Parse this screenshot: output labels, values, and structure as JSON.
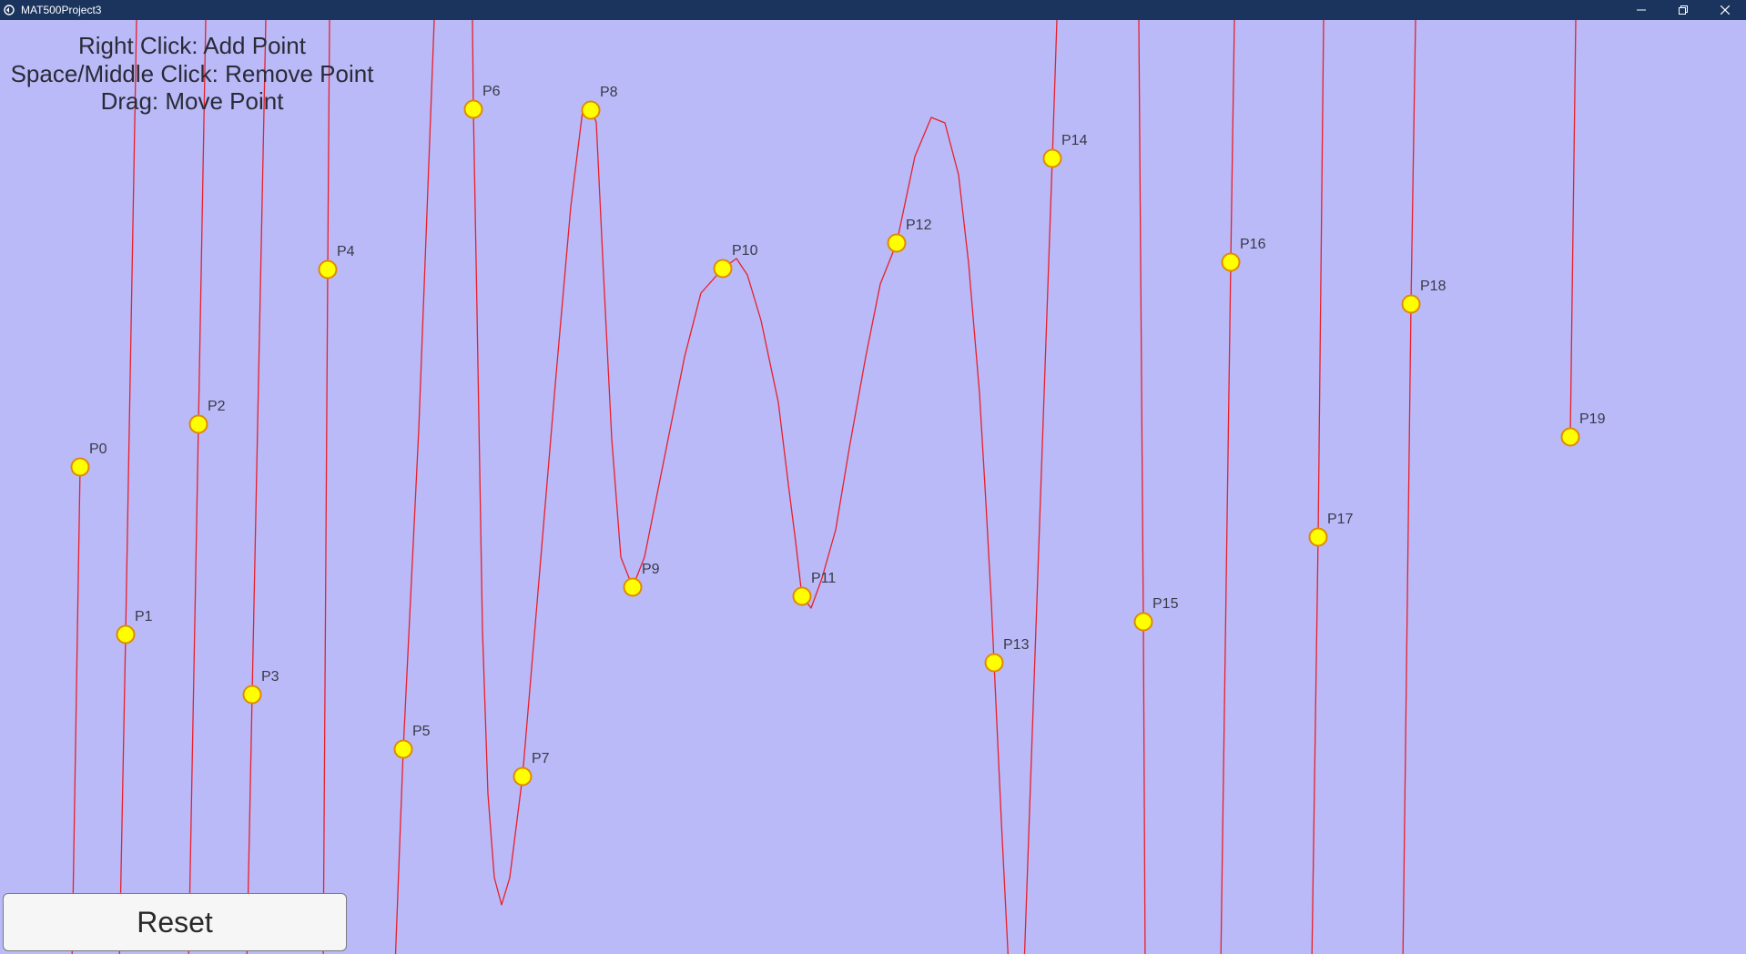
{
  "window": {
    "title": "MAT500Project3",
    "icons": {
      "app": "app-icon",
      "minimize": "minimize-icon",
      "maximize": "restore-icon",
      "close": "close-icon"
    }
  },
  "instructions": {
    "line1": "Right Click: Add Point",
    "line2": "Space/Middle Click: Remove Point",
    "line3": "Drag: Move Point"
  },
  "reset_label": "Reset",
  "colors": {
    "background": "#babaf8",
    "curve": "#e8202a",
    "point_fill": "#ffff00",
    "point_stroke": "#e08a00",
    "titlebar": "#1a345e"
  },
  "control_points": [
    {
      "label": "P0"
    },
    {
      "label": "P1"
    },
    {
      "label": "P2"
    },
    {
      "label": "P3"
    },
    {
      "label": "P4"
    },
    {
      "label": "P5"
    },
    {
      "label": "P6"
    },
    {
      "label": "P7"
    },
    {
      "label": "P8"
    },
    {
      "label": "P9"
    },
    {
      "label": "P10"
    },
    {
      "label": "P11"
    },
    {
      "label": "P12"
    },
    {
      "label": "P13"
    },
    {
      "label": "P14"
    },
    {
      "label": "P15"
    },
    {
      "label": "P16"
    },
    {
      "label": "P17"
    },
    {
      "label": "P18"
    },
    {
      "label": "P19"
    }
  ]
}
